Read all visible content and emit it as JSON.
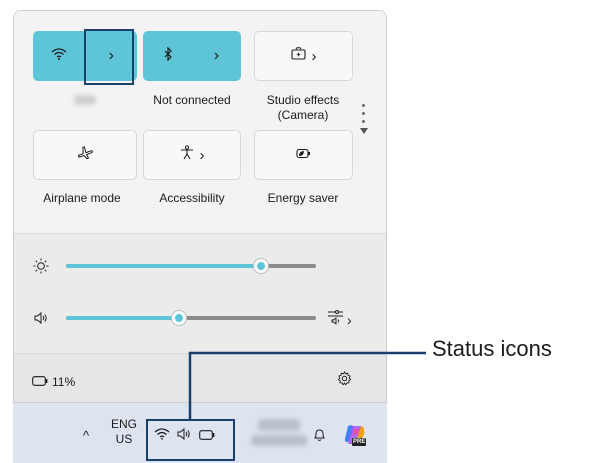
{
  "quick_settings": {
    "tiles": [
      {
        "id": "wifi",
        "label": "",
        "active": true,
        "icon": "wifi-icon",
        "chevron": "›"
      },
      {
        "id": "bluetooth",
        "label": "Not connected",
        "active": true,
        "icon": "bluetooth-icon",
        "chevron": "›"
      },
      {
        "id": "studio_effects",
        "label": "Studio effects (Camera)",
        "active": false,
        "icon": "camera-effects-icon",
        "chevron": "›"
      },
      {
        "id": "airplane",
        "label": "Airplane mode",
        "active": false,
        "icon": "airplane-icon"
      },
      {
        "id": "accessibility",
        "label": "Accessibility",
        "active": false,
        "icon": "accessibility-icon",
        "chevron": "›"
      },
      {
        "id": "energy_saver",
        "label": "Energy saver",
        "active": false,
        "icon": "energy-saver-icon"
      }
    ],
    "sliders": {
      "brightness": {
        "icon": "brightness-icon",
        "value": 0.78
      },
      "volume": {
        "icon": "volume-icon",
        "value": 0.45,
        "output_chevron": "›"
      }
    },
    "battery": {
      "percent": "11%",
      "icon": "battery-icon"
    },
    "settings_icon": "gear-icon"
  },
  "taskbar": {
    "chevron": "^",
    "language_top": "ENG",
    "language_bottom": "US",
    "status_icons": [
      "wifi-icon",
      "volume-icon",
      "battery-icon"
    ],
    "notification_icon": "bell-icon",
    "copilot_badge": "PRE"
  },
  "callout": {
    "label": "Status icons"
  },
  "colors": {
    "accent": "#5ec5d8",
    "highlight_border": "#1a3f6b"
  }
}
